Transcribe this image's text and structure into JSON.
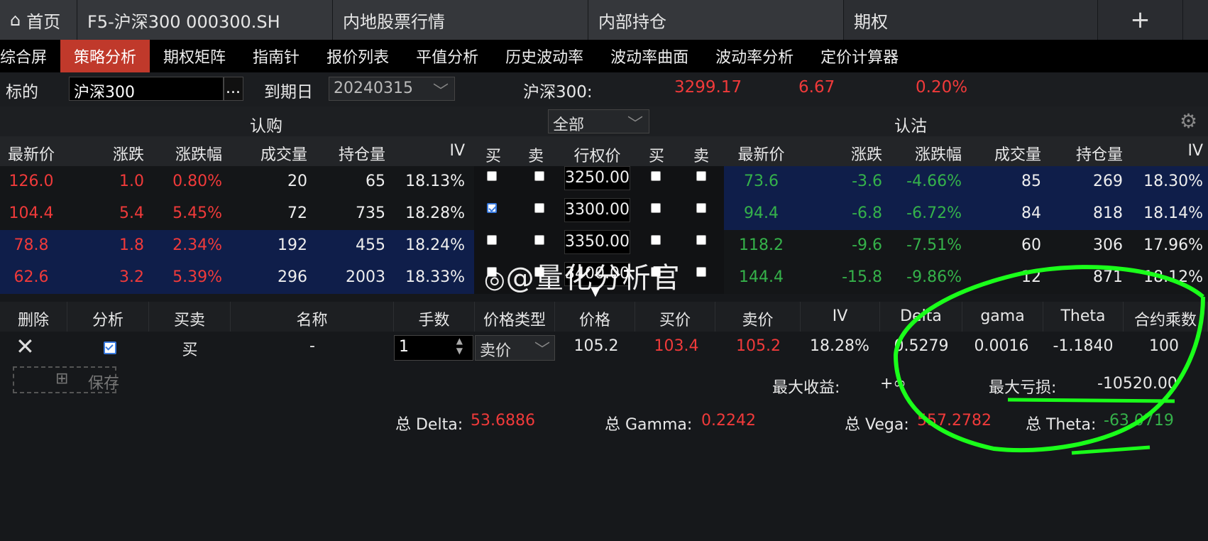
{
  "tabs": [
    {
      "label": "首页",
      "icon": "home-icon"
    },
    {
      "label": "F5-沪深300 000300.SH"
    },
    {
      "label": "内地股票行情"
    },
    {
      "label": "内部持仓"
    },
    {
      "label": "期权"
    },
    {
      "label": "+"
    }
  ],
  "subnav": [
    "综合屏",
    "策略分析",
    "期权矩阵",
    "指南针",
    "报价列表",
    "平值分析",
    "历史波动率",
    "波动率曲面",
    "波动率分析",
    "定价计算器"
  ],
  "params": {
    "underlying_label": "标的",
    "underlying_value": "沪深300",
    "more": "...",
    "expiry_label": "到期日",
    "expiry_value": "20240315",
    "index_label": "沪深300:",
    "index_price": "3299.17",
    "index_change": "6.67",
    "index_pct": "0.20%"
  },
  "sides": {
    "call": "认购",
    "filter": "全部",
    "put": "认沽"
  },
  "columns": {
    "call": [
      "最新价",
      "涨跌",
      "涨跌幅",
      "成交量",
      "持仓量",
      "IV"
    ],
    "buy": "买",
    "sell": "卖",
    "strike": "行权价",
    "put": [
      "最新价",
      "涨跌",
      "涨跌幅",
      "成交量",
      "持仓量",
      "IV"
    ]
  },
  "rows": [
    {
      "c": [
        "126.0",
        "1.0",
        "0.80%",
        "20",
        "65",
        "18.13%"
      ],
      "strike": "3250.00",
      "p": [
        "73.6",
        "-3.6",
        "-4.66%",
        "85",
        "269",
        "18.30%"
      ]
    },
    {
      "c": [
        "104.4",
        "5.4",
        "5.45%",
        "72",
        "735",
        "18.28%"
      ],
      "strike": "3300.00",
      "p": [
        "94.4",
        "-6.8",
        "-6.72%",
        "84",
        "818",
        "18.14%"
      ]
    },
    {
      "c": [
        "78.8",
        "1.8",
        "2.34%",
        "192",
        "455",
        "18.24%"
      ],
      "strike": "3350.00",
      "p": [
        "118.2",
        "-9.6",
        "-7.51%",
        "60",
        "306",
        "17.96%"
      ]
    },
    {
      "c": [
        "62.6",
        "3.2",
        "5.39%",
        "296",
        "2003",
        "18.33%"
      ],
      "strike": "3400.00",
      "p": [
        "144.4",
        "-15.8",
        "-9.86%",
        "12",
        "871",
        "18.12%"
      ]
    }
  ],
  "watermark": "@量化分析官",
  "bottom_headers": [
    "删除",
    "分析",
    "买卖",
    "名称",
    "手数",
    "价格类型",
    "价格",
    "买价",
    "卖价",
    "IV",
    "Delta",
    "gama",
    "Theta",
    "合约乘数"
  ],
  "position": {
    "side": "买",
    "name": "-",
    "qty": "1",
    "price_type": "卖价",
    "price": "105.2",
    "bid": "103.4",
    "ask": "105.2",
    "iv": "18.28%",
    "delta": "0.5279",
    "gamma": "0.0016",
    "theta": "-1.1840",
    "multiplier": "100"
  },
  "save_label": "保存",
  "max_profit_label": "最大收益:",
  "max_profit": "+∞",
  "max_loss_label": "最大亏损:",
  "max_loss": "-10520.00",
  "totals": {
    "delta_label": "总 Delta:",
    "delta": "53.6886",
    "gamma_label": "总 Gamma:",
    "gamma": "0.2242",
    "vega_label": "总 Vega:",
    "vega": "557.2782",
    "theta_label": "总 Theta:",
    "theta": "-63.0719"
  },
  "colors": {
    "accent": "#c0392b",
    "up": "#f03a3a",
    "down": "#35b24a",
    "highlight": "#0f1e4a",
    "annotation": "#1aff1a"
  }
}
